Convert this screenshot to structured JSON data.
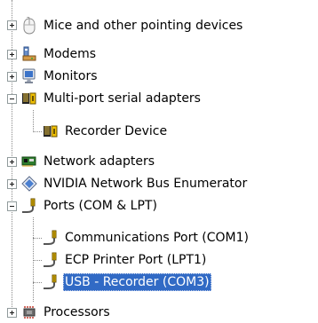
{
  "tree": {
    "items": [
      {
        "label": "Mice and other pointing devices",
        "icon": "mouse-icon",
        "state": "collapsed"
      },
      {
        "label": "Modems",
        "icon": "modem-icon",
        "state": "collapsed"
      },
      {
        "label": "Monitors",
        "icon": "monitor-icon",
        "state": "collapsed"
      },
      {
        "label": "Multi-port serial adapters",
        "icon": "serial-adapter-icon",
        "state": "expanded"
      },
      {
        "label": "Recorder Device",
        "icon": "serial-adapter-icon",
        "state": "leaf"
      },
      {
        "label": "Network adapters",
        "icon": "network-card-icon",
        "state": "collapsed"
      },
      {
        "label": "NVIDIA Network Bus Enumerator",
        "icon": "network-bus-icon",
        "state": "collapsed"
      },
      {
        "label": "Ports (COM & LPT)",
        "icon": "port-connector-icon",
        "state": "expanded"
      },
      {
        "label": "Communications Port (COM1)",
        "icon": "port-connector-icon",
        "state": "leaf"
      },
      {
        "label": "ECP Printer Port (LPT1)",
        "icon": "port-connector-icon",
        "state": "leaf"
      },
      {
        "label": "USB - Recorder (COM3)",
        "icon": "port-connector-icon",
        "state": "leaf",
        "selected": true
      },
      {
        "label": "Processors",
        "icon": "processor-icon",
        "state": "collapsed"
      }
    ]
  },
  "colors": {
    "selection_background": "#316ac5",
    "selection_text": "#ffffff",
    "tree_lines": "#8a8a8a"
  }
}
